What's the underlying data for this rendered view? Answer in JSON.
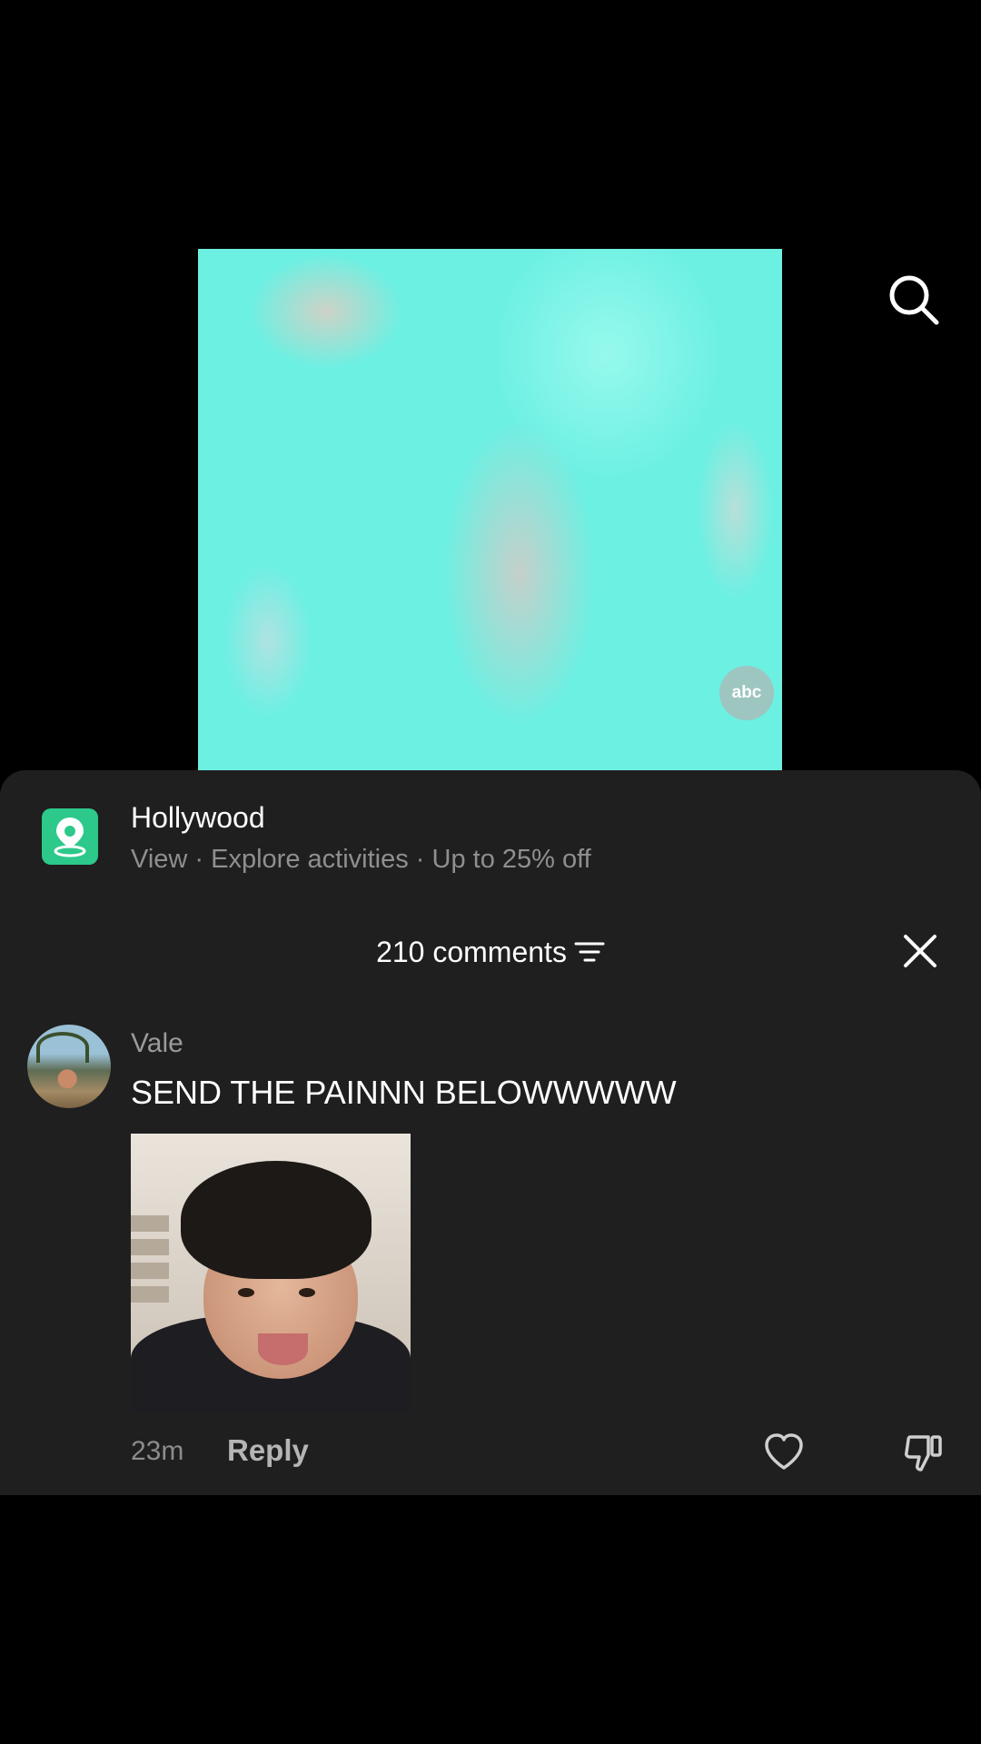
{
  "video": {
    "watermark": "abc"
  },
  "location": {
    "title": "Hollywood",
    "view": "View",
    "explore": "Explore activities",
    "discount": "Up to 25% off",
    "separator": "·"
  },
  "comments": {
    "count_label": "210 comments",
    "items": [
      {
        "user": "Vale",
        "text": "SEND THE PAINNN BELOWWWWW",
        "time": "23m",
        "reply_label": "Reply"
      }
    ]
  },
  "colors": {
    "accent_location": "#2cc98a",
    "sheet_bg": "#1f1f1f"
  }
}
